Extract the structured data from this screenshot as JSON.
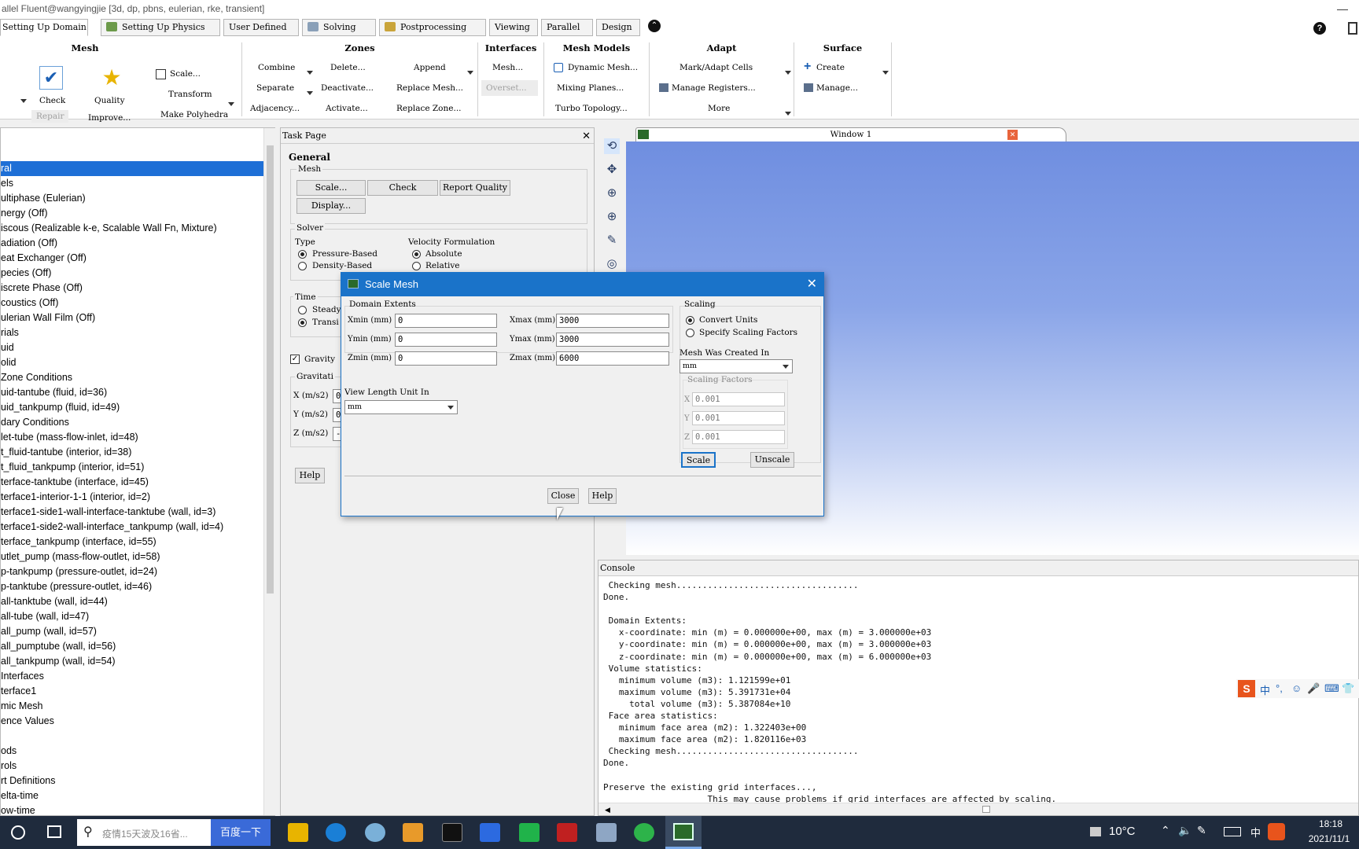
{
  "window": {
    "title": "allel Fluent@wangyingjie  [3d, dp, pbns, eulerian, rke, transient]",
    "minimize": "—"
  },
  "ribbon_tabs": [
    {
      "label": "Setting Up Domain",
      "selected": true
    },
    {
      "label": "Setting Up Physics",
      "icon": "physics-icon"
    },
    {
      "label": "User Defined"
    },
    {
      "label": "Solving",
      "icon": "solving-icon"
    },
    {
      "label": "Postprocessing",
      "icon": "postprocessing-icon"
    },
    {
      "label": "Viewing"
    },
    {
      "label": "Parallel"
    },
    {
      "label": "Design"
    }
  ],
  "ribbon_extra": {
    "collapse": "⌃",
    "help": "?"
  },
  "ribbon": {
    "mesh": {
      "title": "Mesh",
      "check": "Check",
      "quality": "Quality",
      "scale": "Scale...",
      "transform": "Transform",
      "make_polyhedra": "Make Polyhedra",
      "repair": "Repair",
      "improve": "Improve..."
    },
    "zones": {
      "title": "Zones",
      "combine": "Combine",
      "delete": "Delete...",
      "append": "Append",
      "separate": "Separate",
      "deactivate": "Deactivate...",
      "replace_mesh": "Replace Mesh...",
      "adjacency": "Adjacency...",
      "activate": "Activate...",
      "replace_zone": "Replace Zone..."
    },
    "interfaces": {
      "title": "Interfaces",
      "mesh": "Mesh...",
      "overset": "Overset..."
    },
    "mesh_models": {
      "title": "Mesh Models",
      "dynamic_mesh": "Dynamic Mesh...",
      "mixing_planes": "Mixing Planes...",
      "turbo_topology": "Turbo Topology..."
    },
    "adapt": {
      "title": "Adapt",
      "mark_adapt": "Mark/Adapt Cells",
      "manage_registers": "Manage Registers...",
      "more": "More"
    },
    "surface": {
      "title": "Surface",
      "create": "Create",
      "manage": "Manage..."
    }
  },
  "tree": {
    "items": [
      "ral",
      "els",
      "ultiphase (Eulerian)",
      "nergy (Off)",
      "iscous (Realizable k-e, Scalable Wall Fn, Mixture)",
      "adiation (Off)",
      "eat Exchanger (Off)",
      "pecies (Off)",
      "iscrete Phase (Off)",
      "coustics (Off)",
      "ulerian Wall Film (Off)",
      "rials",
      "uid",
      "olid",
      " Zone Conditions",
      "uid-tantube (fluid, id=36)",
      "uid_tankpump (fluid, id=49)",
      "dary Conditions",
      "let-tube (mass-flow-inlet, id=48)",
      "t_fluid-tantube (interior, id=38)",
      "t_fluid_tankpump (interior, id=51)",
      "terface-tanktube (interface, id=45)",
      "terface1-interior-1-1 (interior, id=2)",
      "terface1-side1-wall-interface-tanktube (wall, id=3)",
      "terface1-side2-wall-interface_tankpump (wall, id=4)",
      "terface_tankpump (interface, id=55)",
      "utlet_pump (mass-flow-outlet, id=58)",
      "p-tankpump (pressure-outlet, id=24)",
      "p-tanktube (pressure-outlet, id=46)",
      "all-tanktube (wall, id=44)",
      "all-tube (wall, id=47)",
      "all_pump (wall, id=57)",
      "all_pumptube (wall, id=56)",
      "all_tankpump (wall, id=54)",
      " Interfaces",
      "terface1",
      "mic Mesh",
      "ence Values",
      "",
      "ods",
      "rols",
      "rt Definitions",
      "elta-time",
      "ow-time"
    ]
  },
  "task_page": {
    "title": "Task Page",
    "close": "✕",
    "heading": "General",
    "mesh_label": "Mesh",
    "scale_btn": "Scale...",
    "check_btn": "Check",
    "report_quality_btn": "Report Quality",
    "display_btn": "Display...",
    "solver_label": "Solver",
    "type_label": "Type",
    "pressure_based": "Pressure-Based",
    "density_based": "Density-Based",
    "velocity_label": "Velocity Formulation",
    "absolute": "Absolute",
    "relative": "Relative",
    "time_label": "Time",
    "steady": "Steady",
    "transient": "Transi",
    "gravity": "Gravity",
    "gravitational": "Gravitati",
    "gx": "X (m/s2)",
    "gy": "Y (m/s2)",
    "gz": "Z (m/s2)",
    "gx_val": "0",
    "gy_val": "0",
    "gz_val": "-",
    "help": "Help"
  },
  "graphics": {
    "window_title": "Window 1",
    "close": "✕"
  },
  "console": {
    "title": "Console",
    "text": " Checking mesh...................................\nDone.\n\n Domain Extents:\n   x-coordinate: min (m) = 0.000000e+00, max (m) = 3.000000e+03\n   y-coordinate: min (m) = 0.000000e+00, max (m) = 3.000000e+03\n   z-coordinate: min (m) = 0.000000e+00, max (m) = 6.000000e+03\n Volume statistics:\n   minimum volume (m3): 1.121599e+01\n   maximum volume (m3): 5.391731e+04\n     total volume (m3): 5.387084e+10\n Face area statistics:\n   minimum face area (m2): 1.322403e+00\n   maximum face area (m2): 1.820116e+03\n Checking mesh...................................\nDone.\n\nPreserve the existing grid interfaces...,\n                    This may cause problems if grid interfaces are affected by scaling."
  },
  "dialog": {
    "title": "Scale Mesh",
    "close": "✕",
    "domain_extents": "Domain Extents",
    "xmin_label": "Xmin (mm)",
    "xmin": "0",
    "xmax_label": "Xmax (mm)",
    "xmax": "3000",
    "ymin_label": "Ymin (mm)",
    "ymin": "0",
    "ymax_label": "Ymax (mm)",
    "ymax": "3000",
    "zmin_label": "Zmin (mm)",
    "zmin": "0",
    "zmax_label": "Zmax (mm)",
    "zmax": "6000",
    "view_unit_label": "View Length Unit In",
    "view_unit": "mm",
    "scaling_label": "Scaling",
    "convert_units": "Convert Units",
    "specify_factors": "Specify Scaling Factors",
    "created_in_label": "Mesh Was Created In",
    "created_in": "mm",
    "factors_label": "Scaling Factors",
    "fx_label": "X",
    "fx": "0.001",
    "fy_label": "Y",
    "fy": "0.001",
    "fz_label": "Z",
    "fz": "0.001",
    "scale_btn": "Scale",
    "unscale_btn": "Unscale",
    "close_btn": "Close",
    "help_btn": "Help"
  },
  "ime": {
    "items": [
      "S",
      "中",
      "°,",
      "☺",
      "🎤",
      "⌨",
      "👕"
    ]
  },
  "taskbar": {
    "search_placeholder": "疫情15天波及16省...",
    "search_button": "百度一下",
    "temperature": "10°C",
    "lang": "中",
    "time": "18:18",
    "date": "2021/11/1"
  }
}
